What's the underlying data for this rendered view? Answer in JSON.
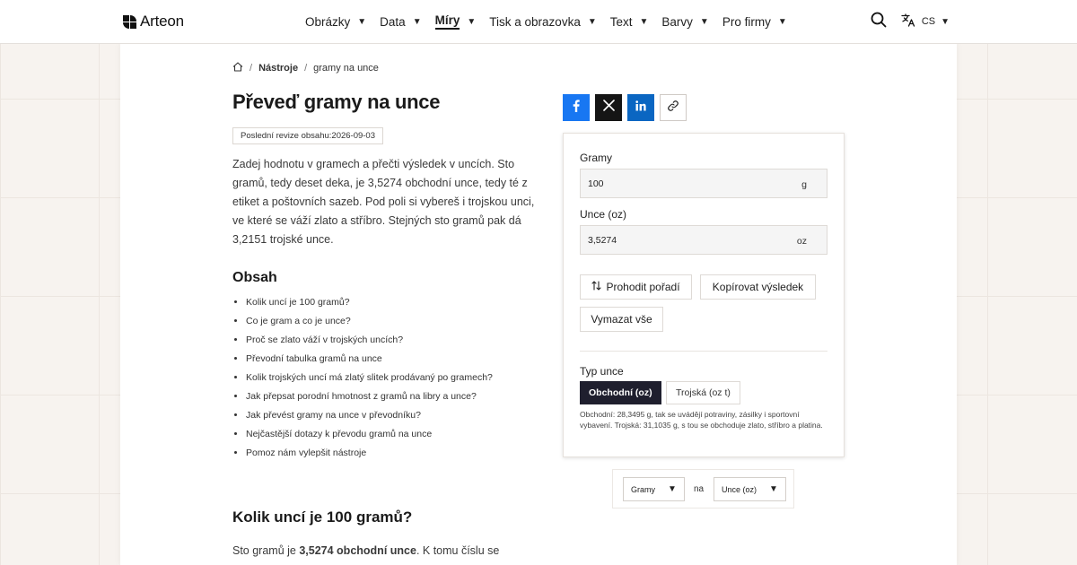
{
  "brand": {
    "name": "Arteon"
  },
  "nav": {
    "items": [
      {
        "label": "Obrázky",
        "active": false
      },
      {
        "label": "Data",
        "active": false
      },
      {
        "label": "Míry",
        "active": true
      },
      {
        "label": "Tisk a obrazovka",
        "active": false
      },
      {
        "label": "Text",
        "active": false
      },
      {
        "label": "Barvy",
        "active": false
      },
      {
        "label": "Pro firmy",
        "active": false
      }
    ],
    "language": "CS"
  },
  "breadcrumb": {
    "section": "Nástroje",
    "current": "gramy na unce"
  },
  "page": {
    "title": "Převeď gramy na unce",
    "revision_label": "Poslední revize obsahu:",
    "revision_date": "2026-09-03",
    "intro": "Zadej hodnotu v gramech a přečti výsledek v uncích. Sto gramů, tedy deset deka, je 3,5274 obchodní unce, tedy té z etiket a poštovních sazeb. Pod poli si vybereš i trojskou unci, ve které se váží zlato a stříbro. Stejných sto gramů pak dá 3,2151 trojské unce."
  },
  "toc": {
    "title": "Obsah",
    "items": [
      "Kolik uncí je 100 gramů?",
      "Co je gram a co je unce?",
      "Proč se zlato váží v trojských uncích?",
      "Převodní tabulka gramů na unce",
      "Kolik trojských uncí má zlatý slitek prodávaný po gramech?",
      "Jak přepsat porodní hmotnost z gramů na libry a unce?",
      "Jak převést gramy na unce v převodníku?",
      "Nejčastější dotazy k převodu gramů na unce",
      "Pomoz nám vylepšit nástroje"
    ]
  },
  "section1": {
    "title": "Kolik uncí je 100 gramů?",
    "text_before": "Sto gramů je ",
    "text_bold": "3,5274 obchodní unce",
    "text_after": ". K tomu číslu se"
  },
  "converter": {
    "grams_label": "Gramy",
    "grams_value": "100",
    "grams_unit": "g",
    "ounces_label": "Unce (oz)",
    "ounces_value": "3,5274",
    "ounces_unit": "oz",
    "swap_label": "Prohodit pořadí",
    "copy_label": "Kopírovat výsledek",
    "clear_label": "Vymazat vše",
    "ounce_type_label": "Typ unce",
    "option_commercial": "Obchodní (oz)",
    "option_troy": "Trojská (oz t)",
    "selected_option": "Obchodní (oz)",
    "note": "Obchodní: 28,3495 g, tak se uvádějí potraviny, zásilky i sportovní vybavení. Trojská: 31,1035 g, s tou se obchoduje zlato, stříbro a platina."
  },
  "direction": {
    "from": "Gramy",
    "connector": "na",
    "to": "Unce (oz)"
  },
  "colors": {
    "accent_dark": "#1f1f2e",
    "facebook": "#1877f2",
    "x": "#151515",
    "linkedin": "#0a66c2"
  }
}
